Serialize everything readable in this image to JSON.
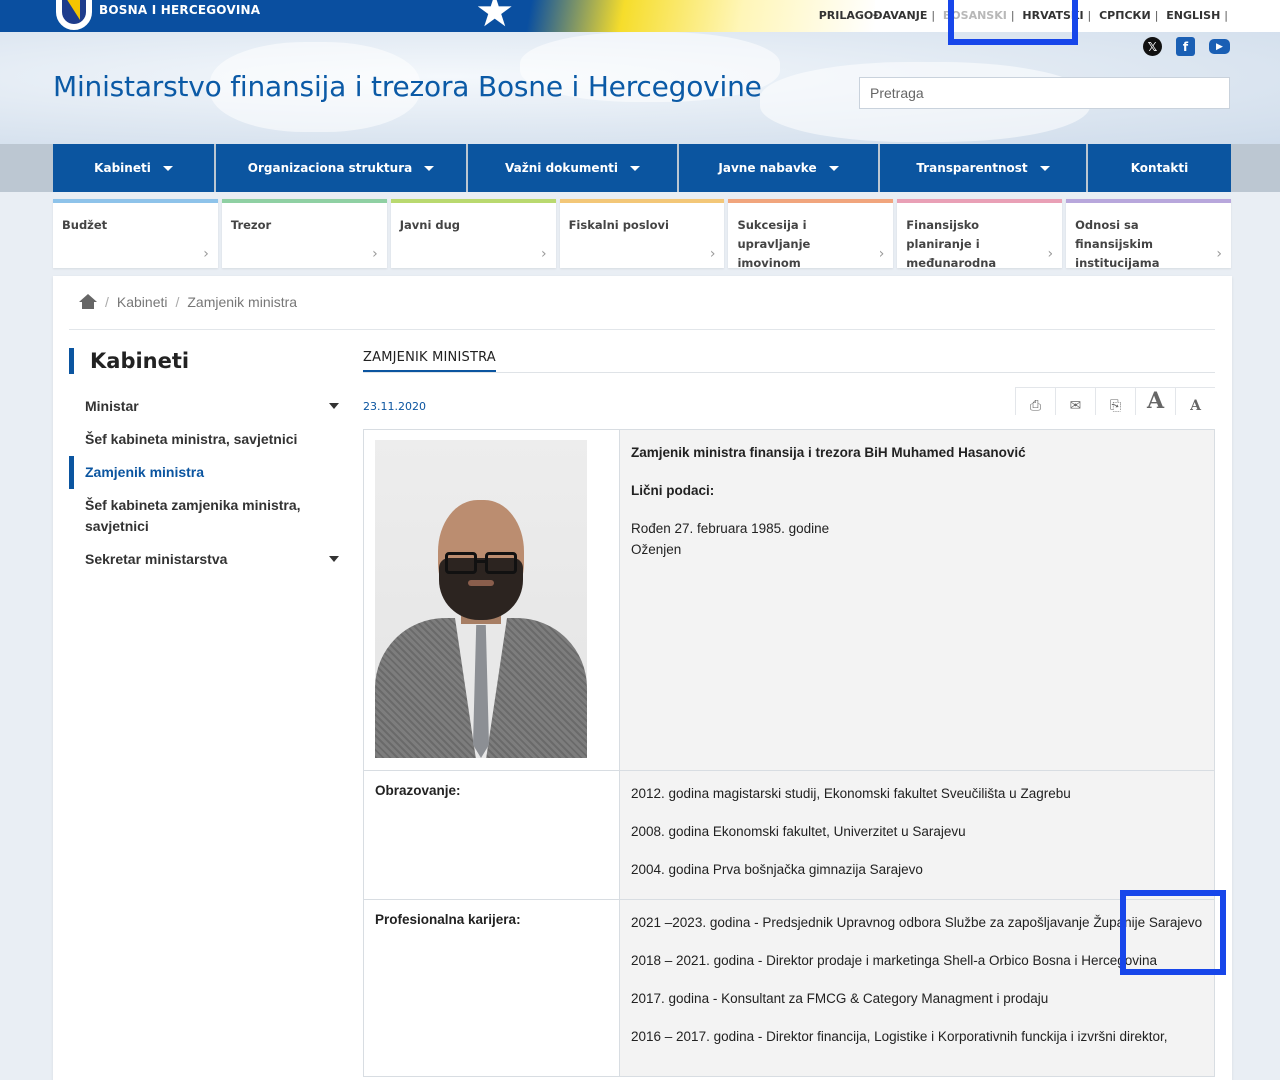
{
  "brand": {
    "title": "BOSNA I HERCEGOVINA"
  },
  "languages": {
    "items": [
      "PRILAGOĐAVANJE",
      "BOSANSKI",
      "HRVATSKI",
      "СРПСКИ",
      "ENGLISH"
    ],
    "active": "BOSANSKI",
    "separator": "|"
  },
  "social": {
    "x_glyph": "𝕏",
    "fb_glyph": "f",
    "yt_glyph": "▶"
  },
  "header": {
    "site_title": "Ministarstvo finansija i trezora Bosne i Hercegovine",
    "search_placeholder": "Pretraga"
  },
  "nav": {
    "items": [
      {
        "label": "Kabineti"
      },
      {
        "label": "Organizaciona struktura"
      },
      {
        "label": "Važni dokumenti"
      },
      {
        "label": "Javne nabavke"
      },
      {
        "label": "Transparentnost"
      },
      {
        "label": "Kontakti"
      }
    ]
  },
  "tiles": [
    {
      "label": "Budžet",
      "color": "#8ec3ea"
    },
    {
      "label": "Trezor",
      "color": "#8fd0a3"
    },
    {
      "label": "Javni dug",
      "color": "#b9d96f"
    },
    {
      "label": "Fiskalni poslovi",
      "color": "#f3c778"
    },
    {
      "label": "Sukcesija i upravljanje imovinom",
      "color": "#f1a57d"
    },
    {
      "label": "Finansijsko planiranje i međunarodna saradnja",
      "color": "#e9a0b6"
    },
    {
      "label": "Odnosi sa finansijskim institucijama",
      "color": "#b8a7dc"
    }
  ],
  "breadcrumb": {
    "items": [
      "Kabineti",
      "Zamjenik ministra"
    ],
    "sep": "/"
  },
  "sidebar": {
    "title": "Kabineti",
    "items": [
      {
        "label": "Ministar"
      },
      {
        "label": "Šef kabineta ministra, savjetnici"
      },
      {
        "label": "Zamjenik ministra"
      },
      {
        "label": "Šef kabineta zamjenika ministra, savjetnici"
      },
      {
        "label": "Sekretar ministarstva"
      }
    ]
  },
  "article": {
    "tab": "ZAMJENIK MINISTRA",
    "date": "23.11.2020",
    "tools": [
      "⎙",
      "✉",
      "⎘",
      "A",
      "A"
    ],
    "intro": {
      "heading": "Zamjenik ministra finansija i trezora BiH Muhamed Hasanović",
      "personal_label": "Lični podaci:",
      "born": "Rođen 27. februara 1985. godine",
      "married": "Oženjen"
    },
    "education": {
      "label": "Obrazovanje:",
      "items": [
        "2012. godina magistarski studij, Ekonomski fakultet Sveučilišta u Zagrebu",
        "2008. godina Ekonomski fakultet, Univerzitet u Sarajevu",
        "2004. godina Prva bošnjačka gimnazija Sarajevo"
      ]
    },
    "career": {
      "label": "Profesionalna karijera:",
      "items": [
        "2021 –2023. godina - Predsjednik Upravnog odbora Službe za zapošljavanje Županije Sarajevo",
        "2018 – 2021. godina - Direktor prodaje i marketinga Shell-a Orbico Bosna i Hercegovina",
        "2017. godina - Konsultant za FMCG & Category Managment i prodaju",
        "2016 – 2017. godina - Direktor financija, Logistike i Korporativnih funckija i izvršni direktor,"
      ]
    }
  }
}
